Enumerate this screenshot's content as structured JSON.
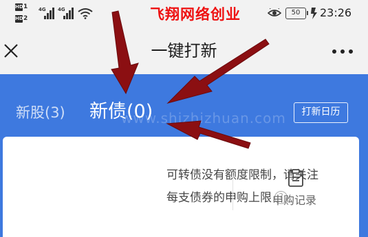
{
  "status_bar": {
    "sim1_badge": "HD",
    "sim1_slot": "1",
    "sim2_badge": "HD",
    "sim2_slot": "2",
    "net1": "4G",
    "net2": "4G",
    "overlay_title": "飞翔网络创业",
    "battery": "50",
    "time": "23:26"
  },
  "title_bar": {
    "title": "一键打新",
    "close_icon": "close-icon",
    "more_icon": "more-icon"
  },
  "header": {
    "tabs": [
      {
        "label": "新股(3)",
        "active": false
      },
      {
        "label": "新债(0)",
        "active": true
      }
    ],
    "calendar_button": "打新日历",
    "watermark": "www.shizhizhuan.com"
  },
  "card": {
    "info_line1": "可转债没有额度限制，请关注",
    "info_line2": "每支债券的申购上限",
    "help_icon": "?",
    "record_label": "申购记录",
    "record_icon": "clipboard-icon"
  },
  "colors": {
    "header_blue": "#3e79df",
    "arrow_red": "#8b0f12",
    "overlay_title_red": "#ee1111"
  }
}
